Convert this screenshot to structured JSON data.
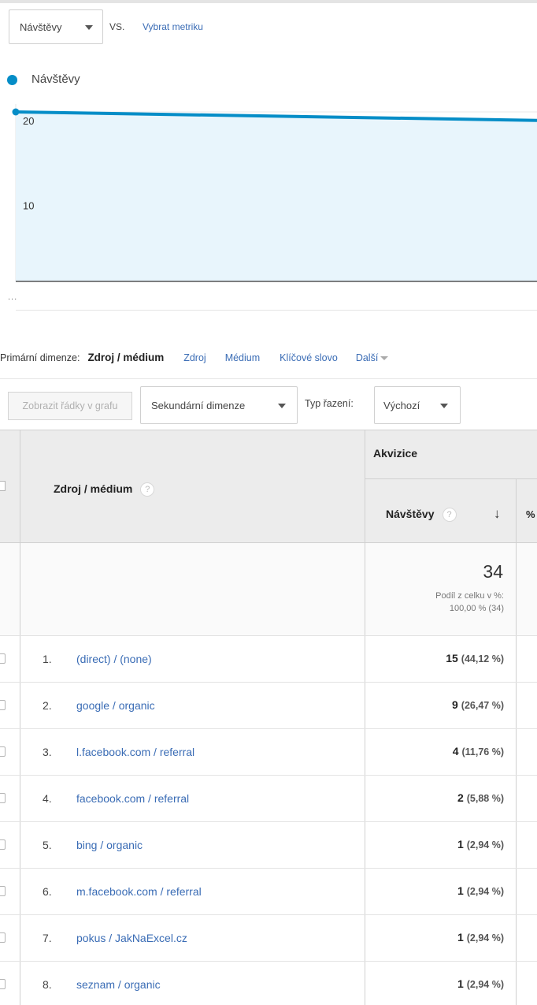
{
  "metric_bar": {
    "selected_metric": "Návštěvy",
    "vs_label": "VS.",
    "pick_metric_label": "Vybrat metriku"
  },
  "chart_data": {
    "type": "area",
    "series": [
      {
        "name": "Návštěvy",
        "values": [
          20,
          19
        ]
      }
    ],
    "y_tick_labels": [
      "20",
      "10"
    ],
    "ylim": [
      0,
      20
    ],
    "color": "#058dc7",
    "fill_color": "#e8f5fc",
    "more_indicator": "..."
  },
  "dimension_bar": {
    "label": "Primární dimenze:",
    "current": "Zdroj / médium",
    "options": [
      "Zdroj",
      "Médium",
      "Klíčové slovo",
      "Další"
    ]
  },
  "controls": {
    "plot_rows_label": "Zobrazit řádky v grafu",
    "secondary_dimension_label": "Sekundární dimenze",
    "sort_type_label": "Typ řazení:",
    "sort_type_value": "Výchozí"
  },
  "table": {
    "dimension_header": "Zdroj / médium",
    "group_header": "Akvizice",
    "metric_header": "Návštěvy",
    "pct_header": "%",
    "help_glyph": "?",
    "total": {
      "value": "34",
      "share_label": "Podíl z celku v %:",
      "share_value": "100,00 % (34)"
    },
    "rows": [
      {
        "num": "1.",
        "source": "(direct) / (none)",
        "value": "15",
        "pct": "(44,12 %)"
      },
      {
        "num": "2.",
        "source": "google / organic",
        "value": "9",
        "pct": "(26,47 %)"
      },
      {
        "num": "3.",
        "source": "l.facebook.com / referral",
        "value": "4",
        "pct": "(11,76 %)"
      },
      {
        "num": "4.",
        "source": "facebook.com / referral",
        "value": "2",
        "pct": "(5,88 %)"
      },
      {
        "num": "5.",
        "source": "bing / organic",
        "value": "1",
        "pct": "(2,94 %)"
      },
      {
        "num": "6.",
        "source": "m.facebook.com / referral",
        "value": "1",
        "pct": "(2,94 %)"
      },
      {
        "num": "7.",
        "source": "pokus / JakNaExcel.cz",
        "value": "1",
        "pct": "(2,94 %)"
      },
      {
        "num": "8.",
        "source": "seznam / organic",
        "value": "1",
        "pct": "(2,94 %)"
      }
    ]
  }
}
